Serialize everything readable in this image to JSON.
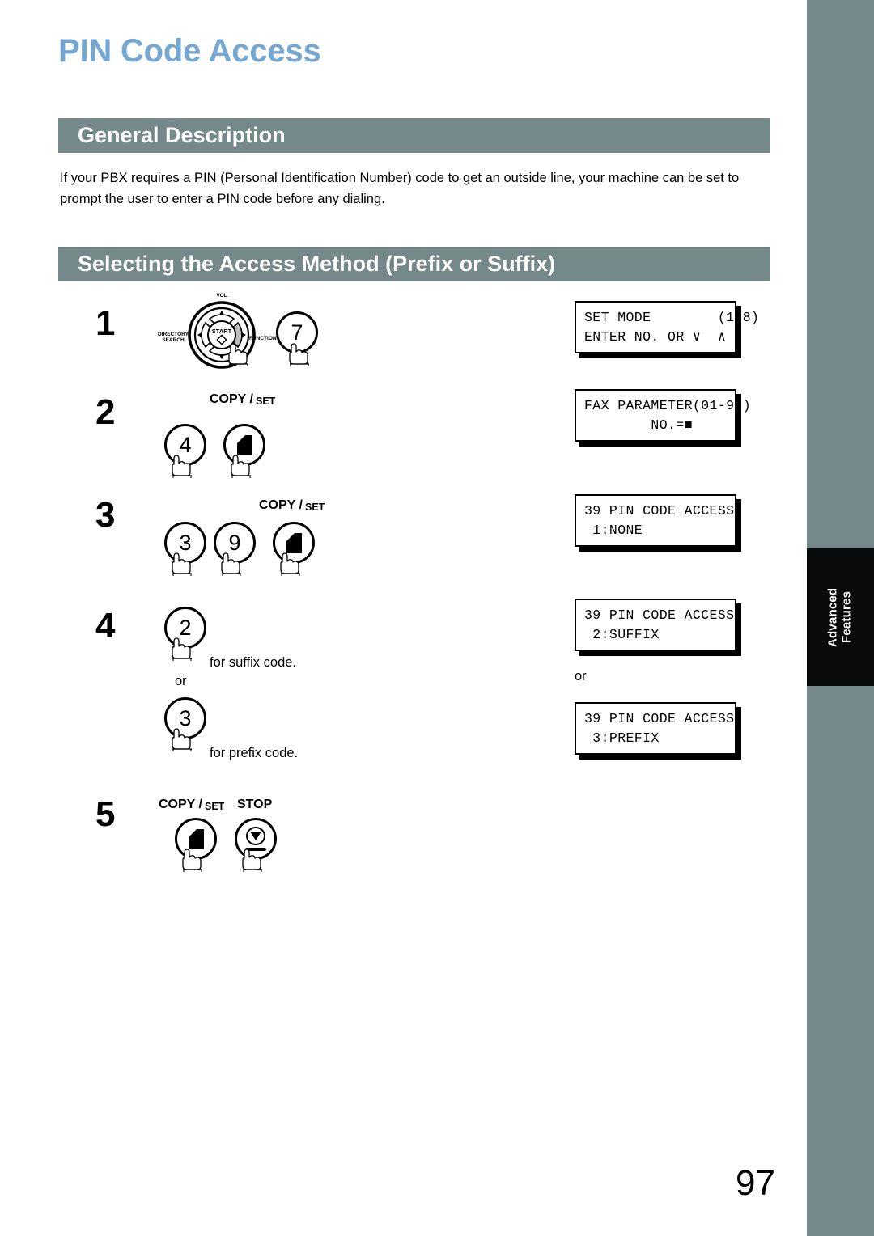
{
  "document": {
    "title": "PIN Code Access",
    "page_number": "97",
    "side_tab_label": "Advanced\nFeatures"
  },
  "colors": {
    "title_blue": "#74a7d1",
    "bar_gray_green": "#75888a",
    "tab_black": "#0a0c0c",
    "text_black": "#000000"
  },
  "sections": [
    {
      "heading": "General Description",
      "paragraph": "If your PBX requires a PIN (Personal Identification Number) code to get an outside line, your machine can be set to prompt the user to enter a PIN code before any dialing."
    },
    {
      "heading": "Selecting the Access Method (Prefix or Suffix)"
    }
  ],
  "steps": [
    {
      "number": "1",
      "keys": [
        {
          "type": "navwheel",
          "name": "navigation-wheel"
        },
        {
          "type": "digit",
          "label": "7"
        }
      ],
      "navwheel": {
        "center": "START",
        "top": "VOL",
        "left": "DIRECTORY\nSEARCH",
        "right": "FUNCTION"
      }
    },
    {
      "number": "2",
      "caption": {
        "copy": "COPY /",
        "set": "SET"
      },
      "keys": [
        {
          "type": "digit",
          "label": "4"
        },
        {
          "type": "copyset",
          "label": "COPY / SET"
        }
      ]
    },
    {
      "number": "3",
      "caption": {
        "copy": "COPY /",
        "set": "SET"
      },
      "keys": [
        {
          "type": "digit",
          "label": "3"
        },
        {
          "type": "digit",
          "label": "9"
        },
        {
          "type": "copyset",
          "label": "COPY / SET"
        }
      ]
    },
    {
      "number": "4",
      "keys": [
        {
          "type": "digit",
          "label": "2"
        },
        {
          "type": "digit",
          "label": "3"
        }
      ],
      "notes": {
        "suffix": "for suffix code.",
        "or": "or",
        "prefix": "for prefix code."
      }
    },
    {
      "number": "5",
      "caption": {
        "copy": "COPY /",
        "set": "SET",
        "stop": "STOP"
      },
      "keys": [
        {
          "type": "copyset",
          "label": "COPY / SET"
        },
        {
          "type": "stop",
          "label": "STOP"
        }
      ]
    }
  ],
  "displays": [
    {
      "id": "lcd-set-mode",
      "line1": "SET MODE        (1-8)",
      "line2": "ENTER NO. OR ∨  ∧"
    },
    {
      "id": "lcd-fax-param",
      "line1": "FAX PARAMETER(01-99)",
      "line2": "        NO.=■"
    },
    {
      "id": "lcd-pin-none",
      "line1": "39 PIN CODE ACCESS",
      "line2": " 1:NONE"
    },
    {
      "id": "lcd-pin-suffix",
      "line1": "39 PIN CODE ACCESS",
      "line2": " 2:SUFFIX"
    },
    {
      "id": "lcd-pin-prefix",
      "line1": "39 PIN CODE ACCESS",
      "line2": " 3:PREFIX"
    }
  ],
  "display_or": "or"
}
